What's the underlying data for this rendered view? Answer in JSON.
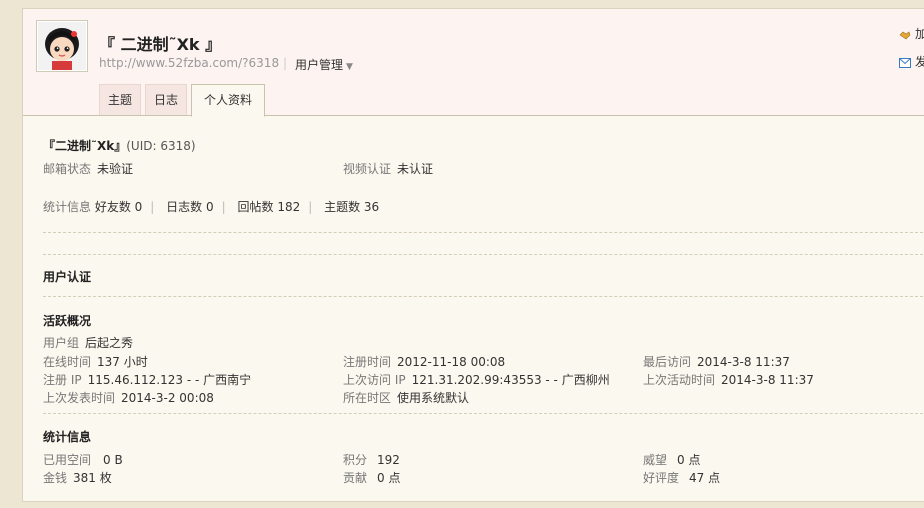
{
  "profile": {
    "username": "『 二进制˜Xk 』",
    "url": "http://www.52fzba.com/?6318",
    "manage_label": "用户管理"
  },
  "right_actions": {
    "action1": "加",
    "action2": "发"
  },
  "tabs": [
    {
      "label": "主题"
    },
    {
      "label": "日志"
    },
    {
      "label": "个人资料",
      "active": true
    }
  ],
  "info": {
    "name_line": "『二进制˜Xk』",
    "uid": "(UID: 6318)",
    "email_label": "邮箱状态",
    "email_value": "未验证",
    "video_label": "视频认证",
    "video_value": "未认证",
    "stats_label": "统计信息",
    "friends": "好友数 0",
    "blogs": "日志数 0",
    "replies": "回帖数 182",
    "threads": "主题数 36"
  },
  "auth": {
    "title": "用户认证"
  },
  "activity": {
    "title": "活跃概况",
    "group_label": "用户组",
    "group_value": "后起之秀",
    "online_label": "在线时间",
    "online_value": "137 小时",
    "reg_time_label": "注册时间",
    "reg_time_value": "2012-11-18 00:08",
    "last_visit_label": "最后访问",
    "last_visit_value": "2014-3-8 11:37",
    "reg_ip_label": "注册 IP",
    "reg_ip_value": "115.46.112.123 - - 广西南宁",
    "prev_ip_label": "上次访问 IP",
    "prev_ip_value": "121.31.202.99:43553 - - 广西柳州",
    "last_active_label": "上次活动时间",
    "last_active_value": "2014-3-8 11:37",
    "last_post_label": "上次发表时间",
    "last_post_value": "2014-3-2 00:08",
    "tz_label": "所在时区",
    "tz_value": "使用系统默认"
  },
  "stats": {
    "title": "统计信息",
    "space_label": "已用空间",
    "space_value": "0 B",
    "points_label": "积分",
    "points_value": "192",
    "prestige_label": "威望",
    "prestige_value": "0 点",
    "money_label": "金钱",
    "money_value": "381 枚",
    "contrib_label": "贡献",
    "contrib_value": "0 点",
    "rating_label": "好评度",
    "rating_value": "47 点"
  }
}
